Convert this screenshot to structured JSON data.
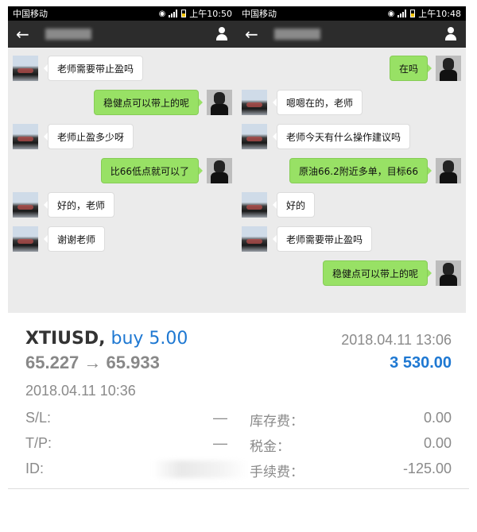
{
  "phones": {
    "left": {
      "carrier": "中国移动",
      "time": "上午10:50",
      "messages": [
        {
          "side": "in",
          "text": "老师需要带止盈吗"
        },
        {
          "side": "out",
          "text": "稳健点可以带上的呢"
        },
        {
          "side": "in",
          "text": "老师止盈多少呀"
        },
        {
          "side": "out",
          "text": "比66低点就可以了"
        },
        {
          "side": "in",
          "text": "好的，老师"
        },
        {
          "side": "in",
          "text": "谢谢老师"
        }
      ]
    },
    "right": {
      "carrier": "中国移动",
      "time": "上午10:48",
      "messages": [
        {
          "side": "out",
          "text": "在吗"
        },
        {
          "side": "in",
          "text": "嗯嗯在的，老师"
        },
        {
          "side": "in",
          "text": "老师今天有什么操作建议吗"
        },
        {
          "side": "out",
          "text": "原油66.2附近多单，目标66"
        },
        {
          "side": "in",
          "text": "好的"
        },
        {
          "side": "in",
          "text": "老师需要带止盈吗"
        },
        {
          "side": "out",
          "text": "稳健点可以带上的呢"
        }
      ]
    }
  },
  "trade": {
    "symbol": "XTIUSD,",
    "side_label": "buy 5.00",
    "close_date": "2018.04.11 13:06",
    "prices": "65.227 → 65.933",
    "profit": "3 530.00",
    "open_date": "2018.04.11 10:36",
    "rows": [
      {
        "k1": "S/L:",
        "v1": "—",
        "k2": "库存费：",
        "v2": "0.00"
      },
      {
        "k1": "T/P:",
        "v1": "—",
        "k2": "税金：",
        "v2": "0.00"
      },
      {
        "k1": "ID:",
        "v1": "",
        "k2": "手续费：",
        "v2": "-125.00"
      }
    ]
  },
  "colors": {
    "outgoing_bubble": "#98e165",
    "accent_blue": "#1e78d2",
    "app_bar": "#2c2c2c"
  }
}
